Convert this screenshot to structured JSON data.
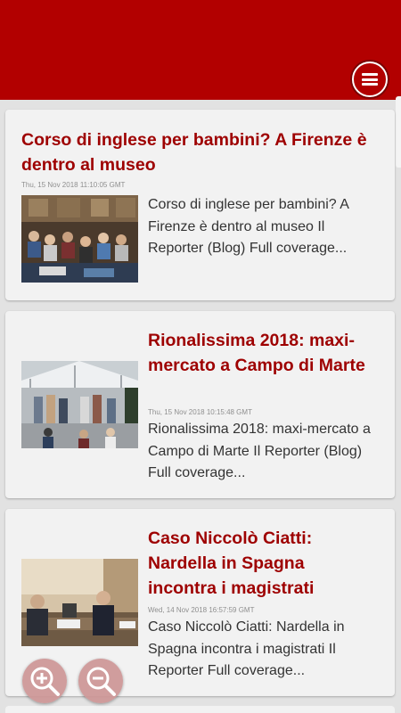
{
  "menu": {
    "icon": "hamburger-menu-icon"
  },
  "articles": [
    {
      "title": "Corso di inglese per bambini? A Firenze è dentro al museo",
      "date": "Thu, 15 Nov 2018 11:10:05 GMT",
      "summary": "Corso di inglese per bambini? A Firenze è dentro al museo  Il Reporter (Blog)  Full coverage...",
      "thumbnail": "photo-children-in-museum-hall"
    },
    {
      "title": "Rionalissima 2018: maxi-mercato a Campo di Marte",
      "date": "Thu, 15 Nov 2018 10:15:48 GMT",
      "summary": "Rionalissima 2018: maxi-mercato a Campo di Marte  Il Reporter (Blog)  Full coverage...",
      "thumbnail": "photo-market-tent-stalls"
    },
    {
      "title": "Caso Niccolò Ciatti: Nardella in Spagna incontra i magistrati",
      "date": "Wed, 14 Nov 2018 16:57:59 GMT",
      "summary": "Caso Niccolò Ciatti: Nardella in Spagna incontra i magistrati  Il Reporter  Full coverage...",
      "thumbnail": "photo-men-at-meeting-table"
    }
  ],
  "zoom": {
    "in_icon": "zoom-in-icon",
    "out_icon": "zoom-out-icon"
  },
  "colors": {
    "appbar": "#b20000",
    "title": "#9e0000",
    "zoom_button": "#cd9696"
  }
}
